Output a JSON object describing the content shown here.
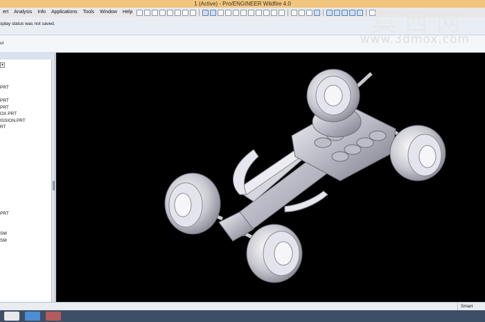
{
  "window": {
    "title": "1 (Active) - Pro/ENGINEER Wildfire 4.0"
  },
  "menu": {
    "items": [
      "ert",
      "Analysis",
      "Info",
      "Applications",
      "Tools",
      "Window",
      "Help"
    ]
  },
  "message": {
    "text": "splay status was not saved."
  },
  "subbar": {
    "label": "ul"
  },
  "tree": {
    "combo": "▾",
    "items": [
      "PRT",
      "PRT",
      "PRT",
      "OX.PRT",
      "ISSION.PRT",
      "RT",
      "PRT",
      "SM",
      "SM"
    ]
  },
  "watermark": {
    "chinese": "莫西网",
    "url": "www.3dmox.com"
  },
  "status": {
    "mode": "Smart"
  },
  "colors": {
    "titlebar": "#f2c57c",
    "viewport_bg": "#000000",
    "taskbar": "#3d4f66"
  }
}
